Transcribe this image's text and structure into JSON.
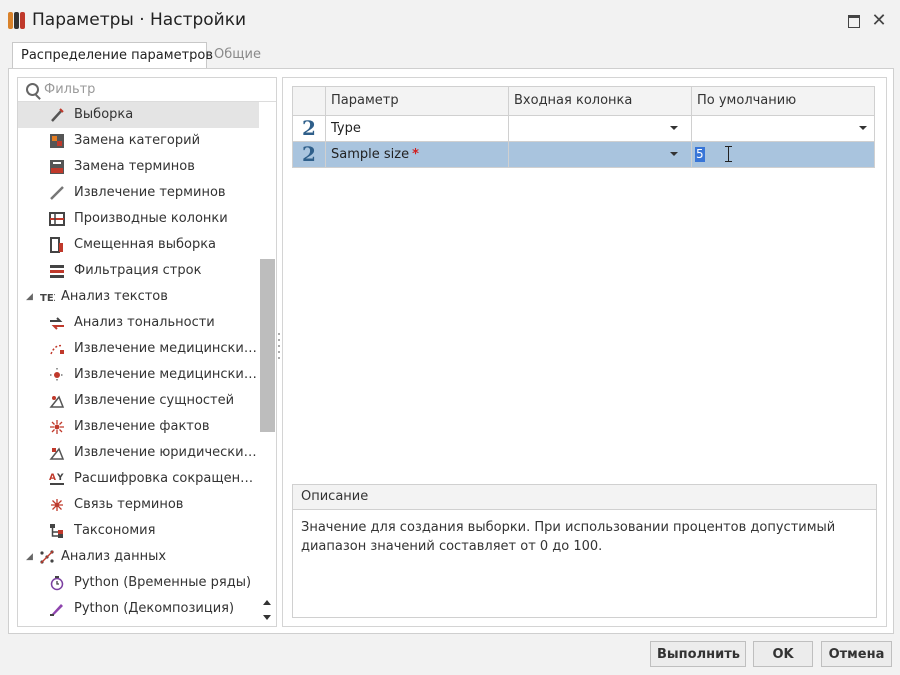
{
  "window": {
    "title": "Параметры · Настройки"
  },
  "tabs": [
    {
      "label": "Распределение параметров",
      "active": true
    },
    {
      "label": "Общие",
      "active": false
    }
  ],
  "filter": {
    "placeholder": "Фильтр",
    "value": ""
  },
  "tree": {
    "items": [
      {
        "label": "Выборка",
        "icon": "sample-icon",
        "selected": true
      },
      {
        "label": "Замена категорий",
        "icon": "replace-categories-icon"
      },
      {
        "label": "Замена терминов",
        "icon": "replace-terms-icon"
      },
      {
        "label": "Извлечение терминов",
        "icon": "extract-terms-icon"
      },
      {
        "label": "Производные колонки",
        "icon": "derived-columns-icon"
      },
      {
        "label": "Смещенная выборка",
        "icon": "biased-sample-icon"
      },
      {
        "label": "Фильтрация строк",
        "icon": "row-filter-icon"
      },
      {
        "label": "Анализ текстов",
        "icon": "text-analysis-icon",
        "group": true
      },
      {
        "label": "Анализ тональности",
        "icon": "sentiment-icon"
      },
      {
        "label": "Извлечение медицинских ...",
        "icon": "medical-extract-icon"
      },
      {
        "label": "Извлечение медицинских ...",
        "icon": "medical-extract-2-icon"
      },
      {
        "label": "Извлечение сущностей",
        "icon": "entities-icon"
      },
      {
        "label": "Извлечение фактов",
        "icon": "facts-icon"
      },
      {
        "label": "Извлечение юридических ...",
        "icon": "legal-extract-icon"
      },
      {
        "label": "Расшифровка сокращений",
        "icon": "abbreviations-icon"
      },
      {
        "label": "Связь терминов",
        "icon": "term-links-icon"
      },
      {
        "label": "Таксономия",
        "icon": "taxonomy-icon"
      },
      {
        "label": "Анализ данных",
        "icon": "data-analysis-icon",
        "group": true
      },
      {
        "label": "Python (Временные ряды)",
        "icon": "python-timeseries-icon"
      },
      {
        "label": "Python (Декомпозиция)",
        "icon": "python-decomposition-icon"
      }
    ]
  },
  "grid": {
    "headers": {
      "param": "Параметр",
      "input_column": "Входная колонка",
      "default": "По умолчанию"
    },
    "rows": [
      {
        "index_glyph": "2",
        "param": "Type",
        "required": "",
        "input_column": "",
        "default": ""
      },
      {
        "index_glyph": "2",
        "param": "Sample size",
        "required": "*",
        "input_column": "",
        "default": "5",
        "selected": true
      }
    ]
  },
  "description": {
    "header": "Описание",
    "text": "Значение для создания выборки. При использовании процентов допустимый диапазон значений составляет от 0 до 100."
  },
  "buttons": {
    "run": "Выполнить",
    "ok": "OK",
    "cancel": "Отмена"
  },
  "colors": {
    "selection": "#a9c4de",
    "text_selection": "#3875d7",
    "index_glyph": "#2f5f8a",
    "required": "#d02020"
  }
}
